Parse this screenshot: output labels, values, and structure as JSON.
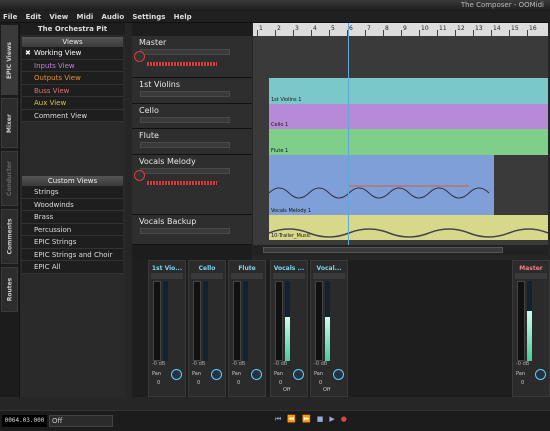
{
  "window": {
    "title": "The Composer - OOMidi"
  },
  "menu": [
    "File",
    "Edit",
    "View",
    "Midi",
    "Audio",
    "Settings",
    "Help"
  ],
  "side_tabs": [
    "EPIC Views",
    "Mixer",
    "Conductor",
    "Comments",
    "Routes"
  ],
  "orchestra": {
    "title": "The Orchestra Pit",
    "views_header": "Views",
    "views": [
      "Working View",
      "Inputs View",
      "Outputs View",
      "Buss View",
      "Aux View",
      "Comment View"
    ],
    "views_colors": [
      "#ffffff",
      "#c87be0",
      "#e09030",
      "#e07070",
      "#e0c050",
      "#dddddd"
    ],
    "custom_header": "Custom Views",
    "custom_views": [
      "Strings",
      "Woodwinds",
      "Brass",
      "Percussion",
      "EPIC Strings",
      "EPIC Strings and Choir",
      "EPIC All"
    ]
  },
  "tracks": [
    {
      "name": "Master"
    },
    {
      "name": "1st Violins"
    },
    {
      "name": "Cello"
    },
    {
      "name": "Flute"
    },
    {
      "name": "Vocals Melody"
    },
    {
      "name": "Vocals Backup"
    }
  ],
  "ruler_numbers": [
    "1",
    "2",
    "3",
    "4",
    "5",
    "6",
    "7",
    "8",
    "9",
    "10",
    "11",
    "12",
    "13",
    "14",
    "15",
    "16"
  ],
  "parts": [
    {
      "label": "1st Violins 1",
      "color": "#7ac8c8"
    },
    {
      "label": "Cello 1",
      "color": "#b78ad8"
    },
    {
      "label": "Flute 1",
      "color": "#7fcf8a"
    },
    {
      "label": "Vocals Melody 1",
      "color": "#7f9fd8"
    },
    {
      "label": "Vocals Melody 1",
      "color": "#7f9fd8"
    },
    {
      "label": "10-Trailer_Music",
      "color": "#d8d88a"
    }
  ],
  "mixer": {
    "strips": [
      {
        "name": "1st Vio...",
        "db": "-0 dB",
        "pan": "0",
        "level": 0
      },
      {
        "name": "Cello",
        "db": "-0 dB",
        "pan": "0",
        "level": 0
      },
      {
        "name": "Flute",
        "db": "-0 dB",
        "pan": "0",
        "level": 0
      },
      {
        "name": "Vocals ...",
        "db": "-0 dB",
        "pan": "0",
        "level": 0.55,
        "off": "Off"
      },
      {
        "name": "Vocal...",
        "db": "-0 dB",
        "pan": "0",
        "level": 0.55,
        "off": "Off"
      },
      {
        "name": "Master",
        "db": "-0 dB",
        "pan": "0",
        "level": 0.62
      }
    ],
    "pan_label": "Pan"
  },
  "status": {
    "position": "0064.03.000",
    "select_value": "Off"
  }
}
